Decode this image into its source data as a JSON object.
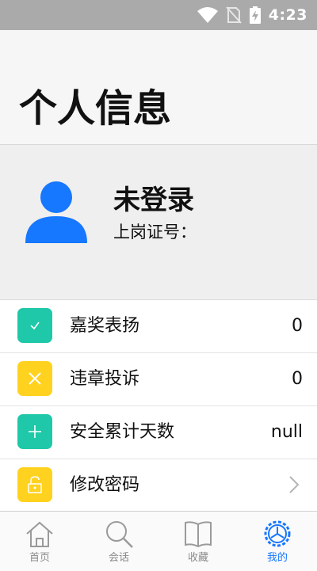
{
  "status_bar": {
    "time": "4:23",
    "icons": [
      "wifi-icon",
      "no-sim-icon",
      "battery-charging-icon"
    ]
  },
  "header": {
    "title": "个人信息"
  },
  "profile": {
    "name": "未登录",
    "cert_label": "上岗证号：",
    "cert_value": "",
    "avatar_icon": "person-icon"
  },
  "menu": {
    "items": [
      {
        "label": "嘉奖表扬",
        "value": "0",
        "icon": "check-icon",
        "color": "#1ec8a8"
      },
      {
        "label": "违章投诉",
        "value": "0",
        "icon": "close-icon",
        "color": "#ffd21f"
      },
      {
        "label": "安全累计天数",
        "value": "null",
        "icon": "plus-icon",
        "color": "#1ec8a8"
      },
      {
        "label": "修改密码",
        "value": "",
        "icon": "unlock-icon",
        "color": "#ffd21f"
      }
    ]
  },
  "tabbar": {
    "tabs": [
      {
        "label": "首页",
        "icon": "home-icon"
      },
      {
        "label": "会话",
        "icon": "search-icon"
      },
      {
        "label": "收藏",
        "icon": "book-icon"
      },
      {
        "label": "我的",
        "icon": "gear-icon"
      }
    ],
    "active_tab": "我的",
    "accent": "#1677ff"
  }
}
